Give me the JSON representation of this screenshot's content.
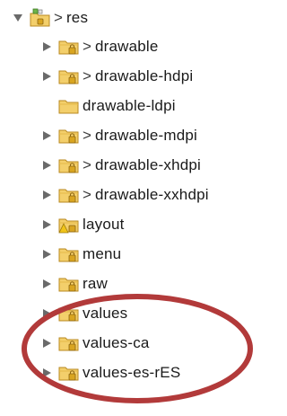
{
  "colors": {
    "folder_fill": "#f3cf6b",
    "folder_stroke": "#b98a22",
    "lock_fill": "#d9a520",
    "annotation": "#b23a3a",
    "twisty": "#6a6a6a"
  },
  "root": {
    "prefix": ">",
    "label": "res",
    "expanded": true,
    "icon": "package-folder-icon"
  },
  "items": [
    {
      "prefix": ">",
      "label": "drawable",
      "expandable": true,
      "icon": "locked-folder-icon"
    },
    {
      "prefix": ">",
      "label": "drawable-hdpi",
      "expandable": true,
      "icon": "locked-folder-icon"
    },
    {
      "prefix": "",
      "label": "drawable-ldpi",
      "expandable": false,
      "icon": "folder-icon"
    },
    {
      "prefix": ">",
      "label": "drawable-mdpi",
      "expandable": true,
      "icon": "locked-folder-icon"
    },
    {
      "prefix": ">",
      "label": "drawable-xhdpi",
      "expandable": true,
      "icon": "locked-folder-icon"
    },
    {
      "prefix": ">",
      "label": "drawable-xxhdpi",
      "expandable": true,
      "icon": "locked-folder-icon"
    },
    {
      "prefix": "",
      "label": "layout",
      "expandable": true,
      "icon": "warning-folder-icon"
    },
    {
      "prefix": "",
      "label": "menu",
      "expandable": true,
      "icon": "locked-folder-icon"
    },
    {
      "prefix": "",
      "label": "raw",
      "expandable": true,
      "icon": "locked-folder-icon"
    },
    {
      "prefix": "",
      "label": "values",
      "expandable": true,
      "icon": "locked-folder-icon"
    },
    {
      "prefix": "",
      "label": "values-ca",
      "expandable": true,
      "icon": "locked-folder-icon"
    },
    {
      "prefix": "",
      "label": "values-es-rES",
      "expandable": true,
      "icon": "locked-folder-icon"
    }
  ]
}
